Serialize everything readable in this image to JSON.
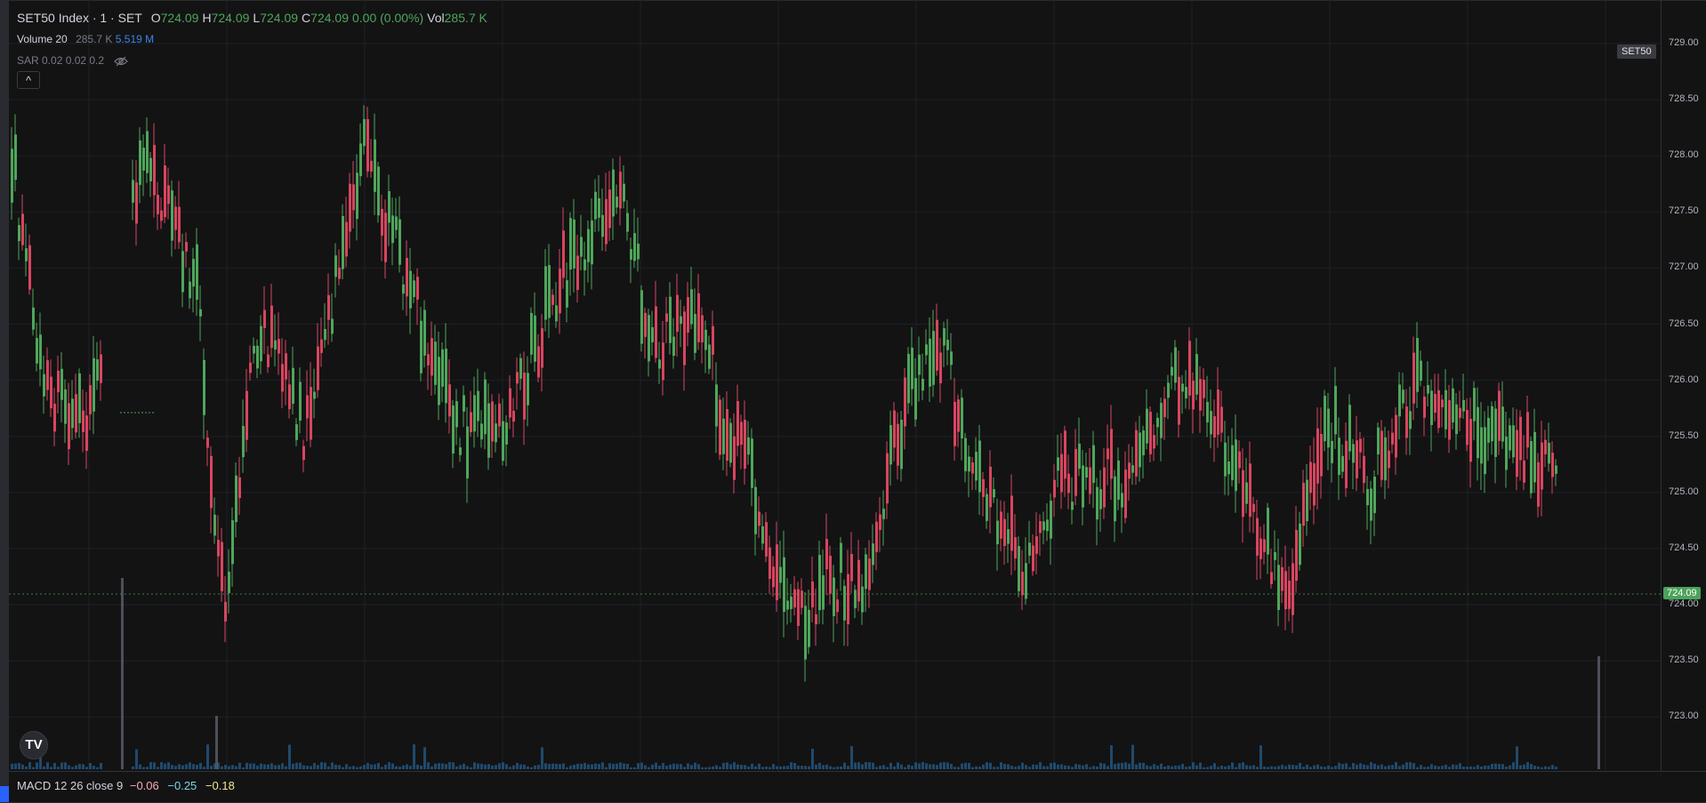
{
  "legend": {
    "symbol": "SET50 Index · 1 · SET",
    "ohlc": [
      {
        "key": "O",
        "value": "724.09"
      },
      {
        "key": "H",
        "value": "724.09"
      },
      {
        "key": "L",
        "value": "724.09"
      },
      {
        "key": "C",
        "value": "724.09"
      },
      {
        "key": "",
        "value": "0.00 (0.00%)"
      },
      {
        "key": "Vol",
        "value": "285.7 K"
      }
    ],
    "volume": {
      "label": "Volume 20",
      "value1": "285.7 K",
      "value2": "5.519 M"
    },
    "sar": {
      "label": "SAR 0.02 0.02 0.2"
    },
    "collapse_glyph": "^"
  },
  "price_scale": {
    "ticks": [
      "729.00",
      "728.50",
      "728.00",
      "727.50",
      "727.00",
      "726.50",
      "726.00",
      "725.50",
      "725.00",
      "724.50",
      "724.00",
      "723.50",
      "723.00"
    ],
    "last_price": "724.09",
    "symbol_tag": "SET50"
  },
  "macd": {
    "label": "MACD 12 26 close 9",
    "macd": "−0.06",
    "signal": "−0.25",
    "hist": "−0.18"
  },
  "colors": {
    "up": "#4fa65a",
    "down": "#d9455f",
    "volume": "#2a6fa8",
    "background": "#131314"
  },
  "logo": "TV",
  "icons": [
    "eye-off-icon",
    "chevron-up-icon",
    "tradingview-logo-icon"
  ]
}
